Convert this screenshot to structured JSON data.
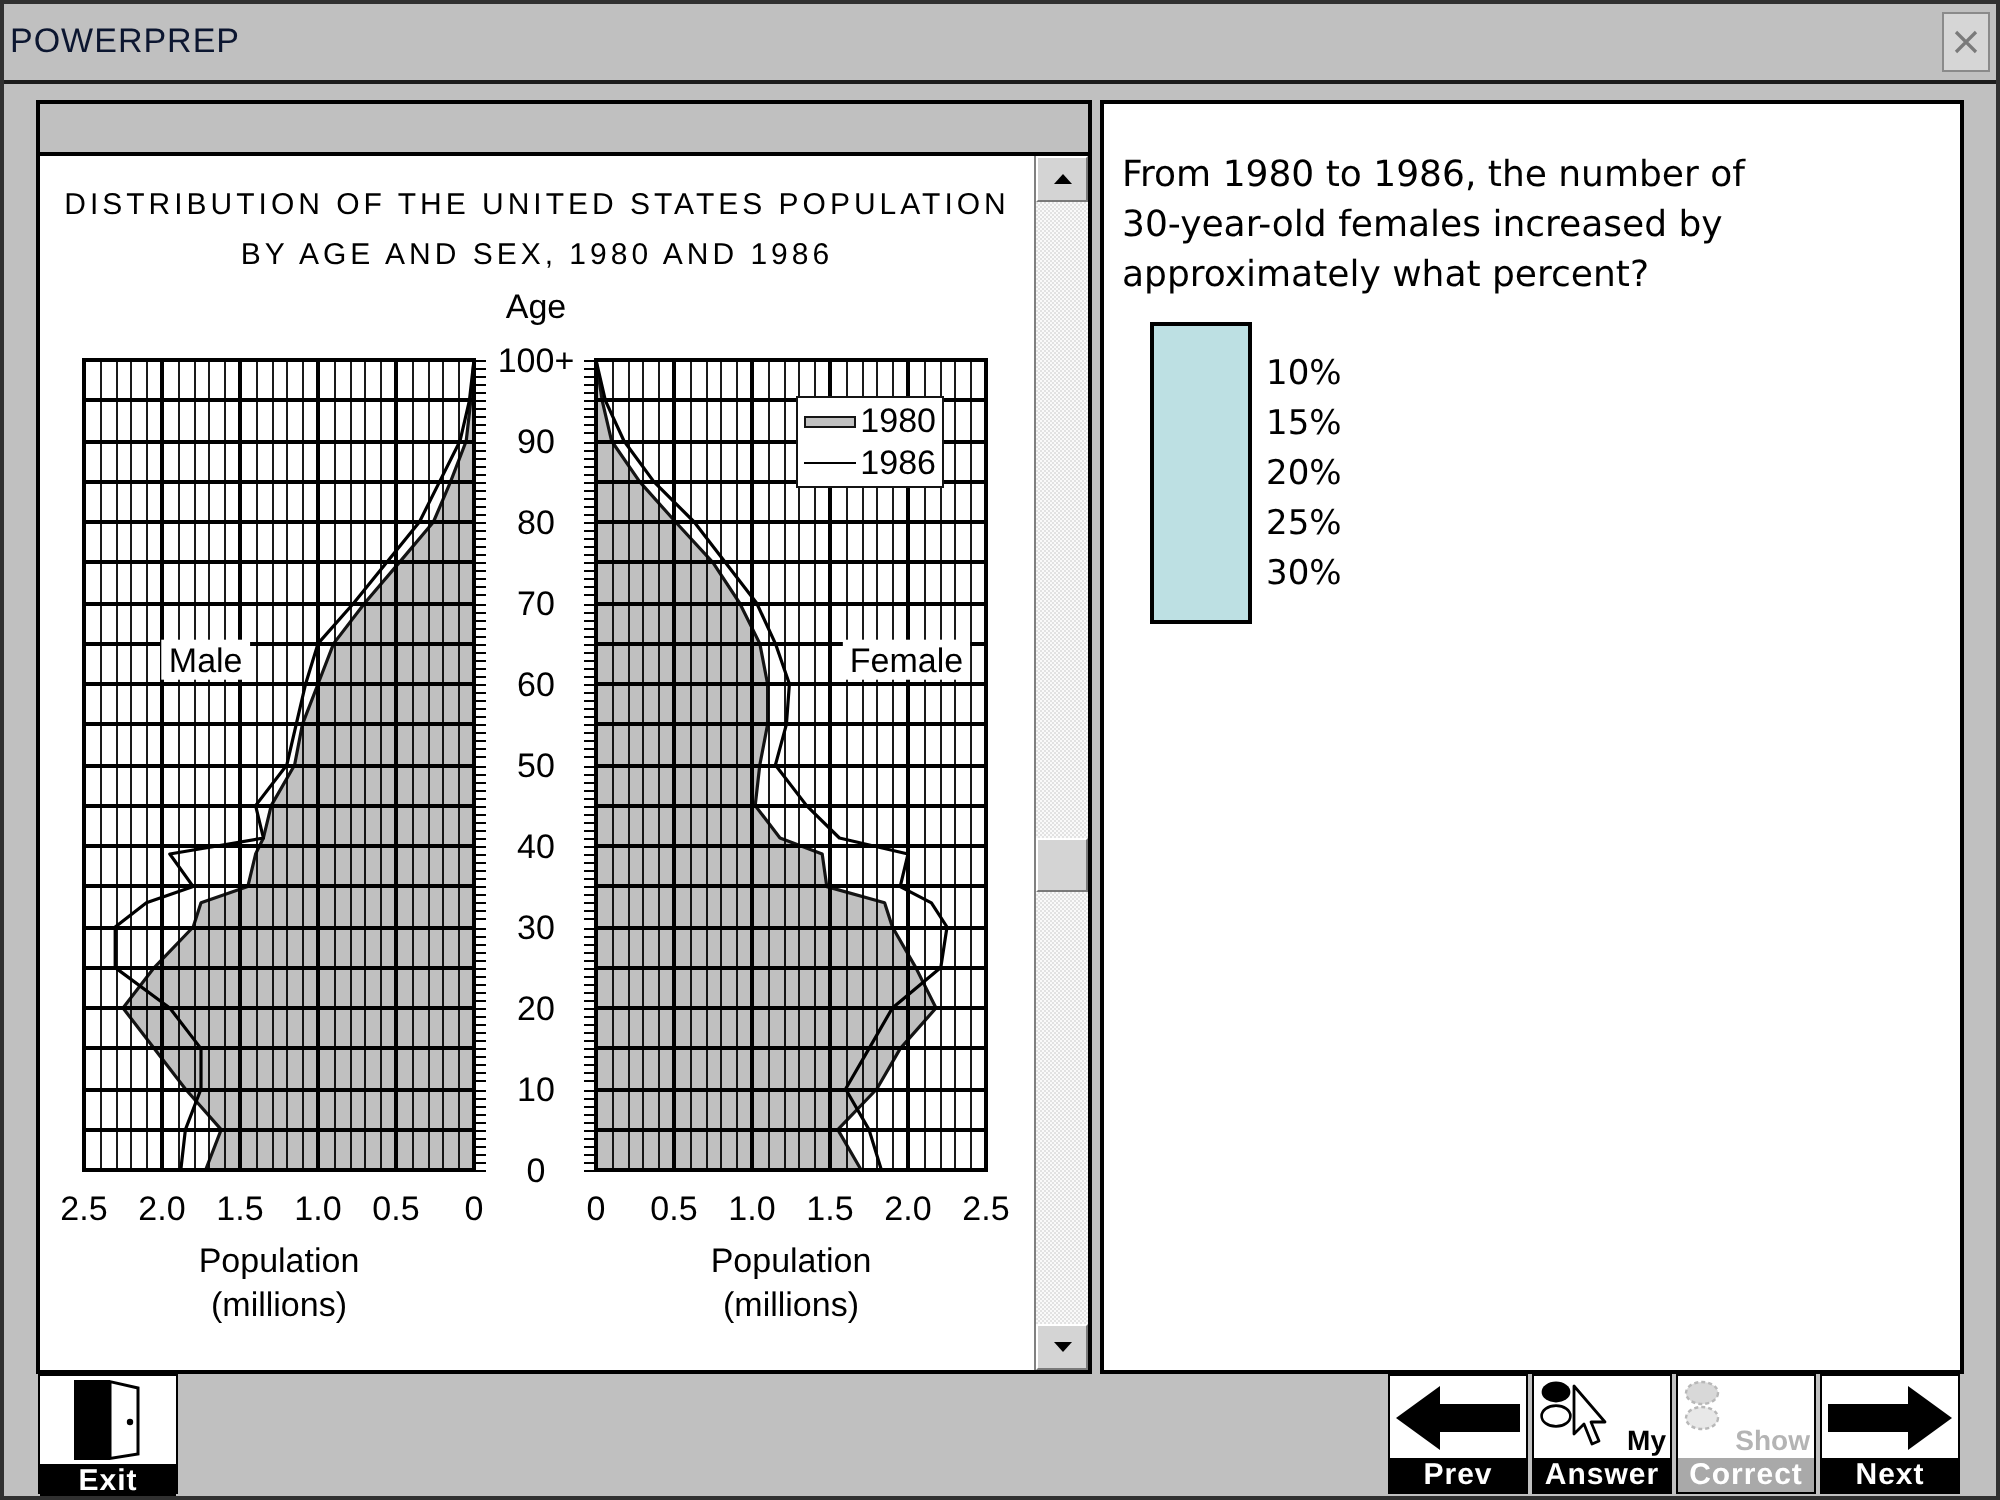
{
  "window": {
    "title": "POWERPREP"
  },
  "chart_panel": {
    "figure": {
      "title": "DISTRIBUTION OF THE UNITED STATES POPULATION BY AGE AND SEX, 1980 AND 1986",
      "panels": [
        {
          "label": "Male",
          "chart_data": {
            "type": "area",
            "orientation": "horizontal",
            "grid": true,
            "xlabel": "Population (millions)",
            "ylabel": "Age",
            "x": [
              0,
              5,
              10,
              15,
              20,
              25,
              30,
              33,
              35,
              39,
              41,
              45,
              50,
              55,
              60,
              65,
              70,
              75,
              80,
              85,
              90,
              95,
              100
            ],
            "xlim": [
              2.5,
              0
            ],
            "ylim": [
              0,
              100
            ],
            "xticks": [
              {
                "value": 2.5,
                "label": "2.5"
              },
              {
                "value": 2,
                "label": "2.0"
              },
              {
                "value": 1.5,
                "label": "1.5"
              },
              {
                "value": 1,
                "label": "1.0"
              },
              {
                "value": 0.5,
                "label": "0.5"
              },
              {
                "value": 0,
                "label": "0"
              }
            ],
            "yticks": [
              {
                "value": 0,
                "label": "0"
              },
              {
                "value": 10,
                "label": "10"
              },
              {
                "value": 20,
                "label": "20"
              },
              {
                "value": 30,
                "label": "30"
              },
              {
                "value": 40,
                "label": "40"
              },
              {
                "value": 50,
                "label": "50"
              },
              {
                "value": 60,
                "label": "60"
              },
              {
                "value": 70,
                "label": "70"
              },
              {
                "value": 80,
                "label": "80"
              },
              {
                "value": 90,
                "label": "90"
              },
              {
                "value": 100,
                "label": "100+"
              }
            ],
            "series": [
              {
                "type": "area",
                "color": "#c0c0c0",
                "values": [
                  1.72,
                  1.62,
                  1.85,
                  2.05,
                  2.25,
                  2.05,
                  1.8,
                  1.75,
                  1.45,
                  1.4,
                  1.35,
                  1.3,
                  1.15,
                  1.1,
                  1.0,
                  0.9,
                  0.7,
                  0.48,
                  0.26,
                  0.15,
                  0.05,
                  0.02,
                  0
                ]
              },
              {
                "type": "line",
                "color": "#000000",
                "values": [
                  1.88,
                  1.85,
                  1.75,
                  1.75,
                  1.95,
                  2.3,
                  2.3,
                  2.1,
                  1.8,
                  1.95,
                  1.35,
                  1.4,
                  1.2,
                  1.14,
                  1.08,
                  1.0,
                  0.77,
                  0.56,
                  0.35,
                  0.22,
                  0.09,
                  0.03,
                  0
                ]
              }
            ]
          }
        },
        {
          "label": "Female",
          "chart_data": {
            "type": "area",
            "orientation": "horizontal",
            "grid": true,
            "xlabel": "Population (millions)",
            "legend": true,
            "x": [
              0,
              5,
              10,
              15,
              20,
              25,
              30,
              33,
              35,
              39,
              41,
              45,
              50,
              55,
              60,
              65,
              70,
              75,
              80,
              85,
              90,
              95,
              100
            ],
            "xlim": [
              0,
              2.5
            ],
            "ylim": [
              0,
              100
            ],
            "xticks": [
              {
                "value": 0,
                "label": "0"
              },
              {
                "value": 0.5,
                "label": "0.5"
              },
              {
                "value": 1,
                "label": "1.0"
              },
              {
                "value": 1.5,
                "label": "1.5"
              },
              {
                "value": 2,
                "label": "2.0"
              },
              {
                "value": 2.5,
                "label": "2.5"
              }
            ],
            "series": [
              {
                "name": "1980",
                "type": "area",
                "color": "#c0c0c0",
                "values": [
                  1.7,
                  1.55,
                  1.8,
                  1.95,
                  2.18,
                  2.05,
                  1.9,
                  1.85,
                  1.48,
                  1.45,
                  1.18,
                  1.02,
                  1.05,
                  1.1,
                  1.1,
                  1.05,
                  0.92,
                  0.75,
                  0.51,
                  0.28,
                  0.1,
                  0.04,
                  0
                ]
              },
              {
                "name": "1986",
                "type": "line",
                "color": "#000000",
                "values": [
                  1.83,
                  1.75,
                  1.6,
                  1.75,
                  1.9,
                  2.21,
                  2.25,
                  2.15,
                  1.95,
                  2.0,
                  1.56,
                  1.35,
                  1.15,
                  1.22,
                  1.24,
                  1.15,
                  1.03,
                  0.83,
                  0.63,
                  0.37,
                  0.18,
                  0.06,
                  0
                ]
              }
            ]
          }
        }
      ]
    }
  },
  "question": {
    "text": "From 1980 to 1986, the number of 30-year-old females increased by approximately what percent?",
    "options": [
      {
        "label": "10%",
        "selected": false
      },
      {
        "label": "15%",
        "selected": false
      },
      {
        "label": "20%",
        "selected": false
      },
      {
        "label": "25%",
        "selected": false
      },
      {
        "label": "30%",
        "selected": false
      }
    ]
  },
  "toolbar": {
    "buttons": [
      {
        "kind": "exit",
        "label": "Exit",
        "disabled": false
      },
      {
        "kind": "prev",
        "label": "Prev",
        "disabled": false
      },
      {
        "kind": "my_answer",
        "top_label": "My",
        "label": "Answer",
        "disabled": false
      },
      {
        "kind": "show_correct",
        "top_label": "Show",
        "label": "Correct",
        "disabled": true
      },
      {
        "kind": "next",
        "label": "Next",
        "disabled": false
      }
    ]
  }
}
